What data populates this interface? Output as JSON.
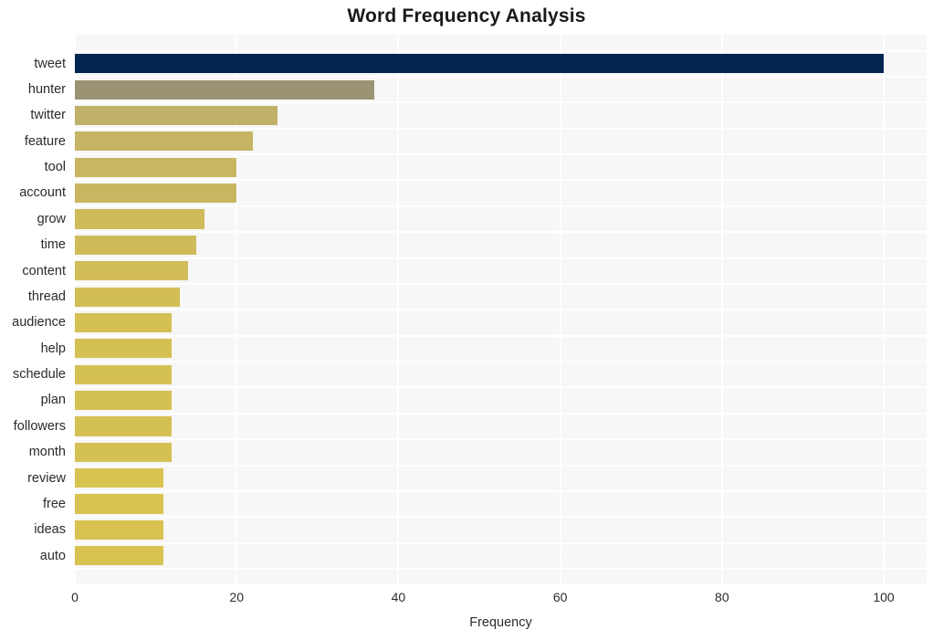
{
  "chart_data": {
    "type": "bar",
    "orientation": "horizontal",
    "title": "Word Frequency Analysis",
    "xlabel": "Frequency",
    "ylabel": "",
    "categories": [
      "tweet",
      "hunter",
      "twitter",
      "feature",
      "tool",
      "account",
      "grow",
      "time",
      "content",
      "thread",
      "audience",
      "help",
      "schedule",
      "plan",
      "followers",
      "month",
      "review",
      "free",
      "ideas",
      "auto"
    ],
    "values": [
      100,
      37,
      25,
      22,
      20,
      20,
      16,
      15,
      14,
      13,
      12,
      12,
      12,
      12,
      12,
      12,
      11,
      11,
      11,
      11
    ],
    "xlim": [
      0,
      105.3
    ],
    "xticks": [
      0,
      20,
      40,
      60,
      80,
      100
    ],
    "xtick_labels": [
      "0",
      "20",
      "40",
      "60",
      "80",
      "100"
    ],
    "grid": true,
    "grid_color": "#ffffff",
    "plot_background": "#f7f7f7",
    "legend": null,
    "bar_colors": [
      "#032552",
      "#9b9474",
      "#c0b16a",
      "#c6b465",
      "#c9b661",
      "#c9b661",
      "#cfba5c",
      "#d0bb5a",
      "#d2bd58",
      "#d3be56",
      "#d5c054",
      "#d5c054",
      "#d5c054",
      "#d5c054",
      "#d5c054",
      "#d5c054",
      "#d8c350",
      "#d8c350",
      "#d8c350",
      "#d8c350"
    ]
  },
  "colors": {
    "title": "#1a1a1a",
    "tick_text": "#2b2b2b",
    "page_background": "#ffffff"
  }
}
